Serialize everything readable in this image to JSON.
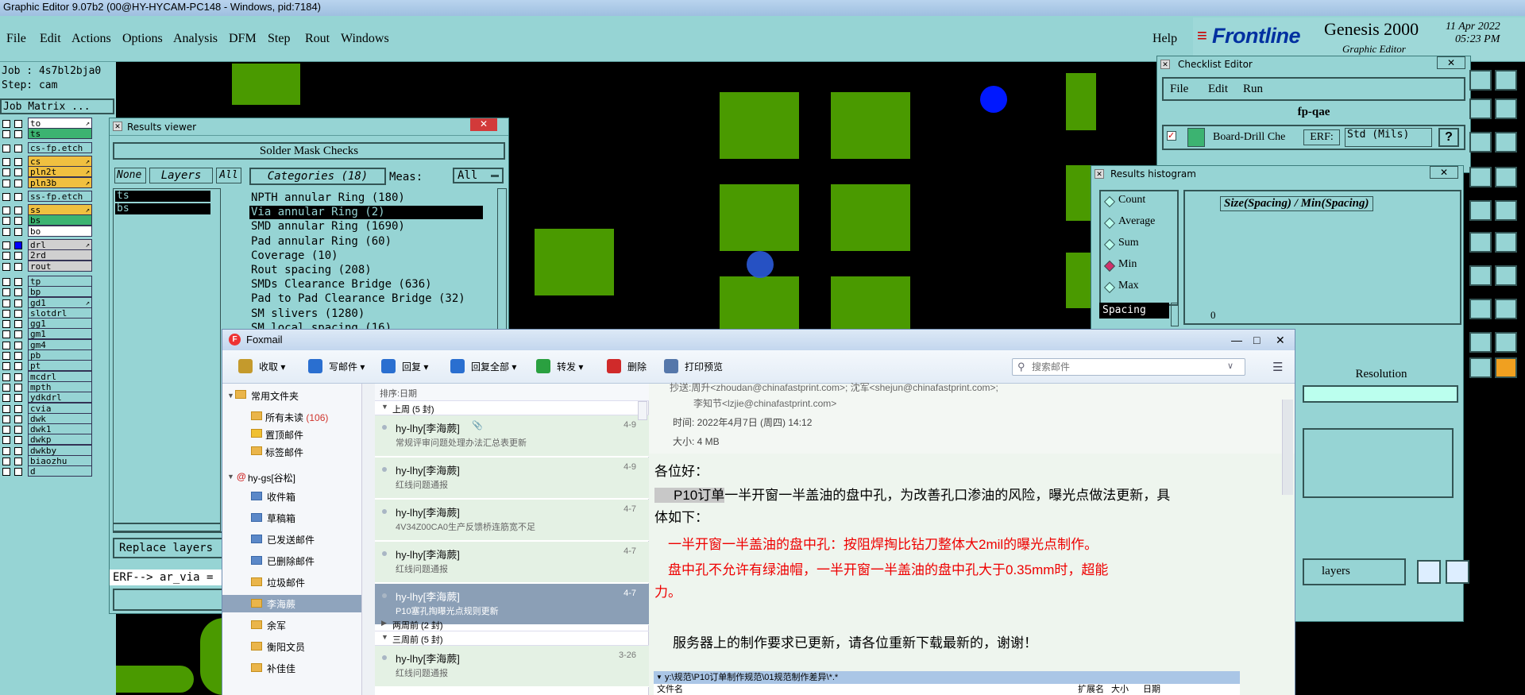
{
  "window_title": "Graphic Editor 9.07b2 (00@HY-HYCAM-PC148 - Windows, pid:7184)",
  "menu": [
    "File",
    "Edit",
    "Actions",
    "Options",
    "Analysis",
    "DFM",
    "Step",
    "Rout",
    "Windows"
  ],
  "help": "Help",
  "brand": {
    "logo": "Frontline",
    "product": "Genesis 2000",
    "subtitle": "Graphic Editor",
    "date": "11 Apr 2022",
    "time": "05:23 PM"
  },
  "job": {
    "job_line": "Job : 4s7bl2bja0",
    "step_line": "Step: cam",
    "matrix_button": "Job Matrix ..."
  },
  "layers": [
    {
      "name": "to",
      "color": "#ffffff",
      "arrow": true
    },
    {
      "name": "ts",
      "color": "#3cb371"
    },
    {
      "name": "cs-fp.etch",
      "color": "#96d4d4"
    },
    {
      "name": "cs",
      "color": "#f0c040",
      "arrow": true
    },
    {
      "name": "pln2t",
      "color": "#f0c040",
      "arrow": true
    },
    {
      "name": "pln3b",
      "color": "#f0c040",
      "arrow": true
    },
    {
      "name": "ss-fp.etch",
      "color": "#96d4d4"
    },
    {
      "name": "ss",
      "color": "#f0c040",
      "arrow": true
    },
    {
      "name": "bs",
      "color": "#3cb371"
    },
    {
      "name": "bo",
      "color": "#ffffff"
    },
    {
      "name": "drl",
      "color": "#d0d0d0",
      "arrow": true
    },
    {
      "name": "2rd",
      "color": "#d0d0d0"
    },
    {
      "name": "rout",
      "color": "#d0d0d0"
    },
    {
      "name": "tp",
      "color": "#96d4d4"
    },
    {
      "name": "bp",
      "color": "#96d4d4"
    },
    {
      "name": "gd1",
      "color": "#96d4d4",
      "arrow": true
    },
    {
      "name": "slotdrl",
      "color": "#96d4d4"
    },
    {
      "name": "gg1",
      "color": "#96d4d4"
    },
    {
      "name": "gm1",
      "color": "#96d4d4"
    },
    {
      "name": "gm4",
      "color": "#96d4d4"
    },
    {
      "name": "pb",
      "color": "#96d4d4"
    },
    {
      "name": "pt",
      "color": "#96d4d4"
    },
    {
      "name": "mcdrl",
      "color": "#96d4d4"
    },
    {
      "name": "mpth",
      "color": "#96d4d4"
    },
    {
      "name": "ydkdrl",
      "color": "#96d4d4"
    },
    {
      "name": "cvia",
      "color": "#96d4d4"
    },
    {
      "name": "dwk",
      "color": "#96d4d4"
    },
    {
      "name": "dwk1",
      "color": "#96d4d4"
    },
    {
      "name": "dwkp",
      "color": "#96d4d4"
    },
    {
      "name": "dwkby",
      "color": "#96d4d4"
    },
    {
      "name": "biaozhu",
      "color": "#96d4d4"
    },
    {
      "name": "d",
      "color": "#96d4d4"
    }
  ],
  "results_viewer": {
    "title": "Results viewer",
    "header": "Solder Mask Checks",
    "none_btn": "None",
    "layers_label": "Layers",
    "all_btn": "All",
    "categories_label": "Categories (18)",
    "meas_label": "Meas:",
    "meas_value": "All",
    "layer_items": [
      "ts",
      "bs"
    ],
    "categories": [
      "NPTH annular Ring (180)",
      "Via annular Ring (2)",
      "SMD annular Ring (1690)",
      "Pad annular Ring (60)",
      "Coverage (10)",
      "Rout spacing (208)",
      "SMDs Clearance Bridge (636)",
      "Pad to Pad Clearance Bridge (32)",
      "SM slivers (1280)",
      "SM local spacing (16)"
    ],
    "replace_btn": "Replace layers",
    "erf_line": "ERF--> ar_via ="
  },
  "checklist_editor": {
    "title": "Checklist Editor",
    "menu": [
      "File",
      "Edit",
      "Run"
    ],
    "name": "fp-qae",
    "row_label": "Board-Drill Che",
    "erf_label": "ERF:",
    "erf_value": "Std (Mils)",
    "help": "?"
  },
  "histogram": {
    "title": "Results histogram",
    "options": [
      "Count",
      "Average",
      "Sum",
      "Min",
      "Max"
    ],
    "selected": "Min",
    "chart_title": "Size(Spacing) / Min(Spacing)",
    "spacing_btn": "Spacing",
    "zero_label": "0",
    "resolution_label": "Resolution",
    "layers_label": "layers"
  },
  "foxmail": {
    "title": "Foxmail",
    "toolbar": [
      {
        "label": "收取",
        "icon": "inbox-icon"
      },
      {
        "label": "写邮件",
        "icon": "pen-icon"
      },
      {
        "label": "回复",
        "icon": "reply-icon"
      },
      {
        "label": "回复全部",
        "icon": "reply-all-icon"
      },
      {
        "label": "转发",
        "icon": "forward-icon"
      },
      {
        "label": "删除",
        "icon": "delete-icon"
      },
      {
        "label": "打印预览",
        "icon": "print-icon"
      }
    ],
    "search_placeholder": "搜索邮件",
    "folders_header": "常用文件夹",
    "folders_common": [
      {
        "name": "所有未读",
        "count": "(106)"
      },
      {
        "name": "置顶邮件"
      },
      {
        "name": "标签邮件"
      }
    ],
    "account": "hy-gs[谷松]",
    "folders_account": [
      "收件箱",
      "草稿箱",
      "已发送邮件",
      "已删除邮件",
      "垃圾邮件",
      "李海蕨",
      "余军",
      "衡阳文员",
      "补佳佳"
    ],
    "sort_label": "排序:日期",
    "group_last_week": "上周 (5 封)",
    "group_two_weeks": "两周前 (2 封)",
    "group_three_weeks": "三周前 (5 封)",
    "messages": [
      {
        "from": "hy-lhy[李海蕨]",
        "date": "4-9",
        "subject": "常规评审问题处理办法汇总表更新",
        "attach": true
      },
      {
        "from": "hy-lhy[李海蕨]",
        "date": "4-9",
        "subject": "红线问题通报"
      },
      {
        "from": "hy-lhy[李海蕨]",
        "date": "4-7",
        "subject": "4V34Z00CA0生产反馈桥连筋宽不足"
      },
      {
        "from": "hy-lhy[李海蕨]",
        "date": "4-7",
        "subject": "红线问题通报"
      },
      {
        "from": "hy-lhy[李海蕨]",
        "date": "4-7",
        "subject": "P10塞孔掏曝光点规则更新",
        "selected": true
      }
    ],
    "message_bottom": {
      "from": "hy-lhy[李海蕨]",
      "date": "3-26",
      "subject": "红线问题通报"
    },
    "read": {
      "cc_line": "抄送:周升<zhoudan@chinafastprint.com>; 沈军<shejun@chinafastprint.com>;",
      "cc_line2": "李知节<lzjie@chinafastprint.com>",
      "time_line": "时间: 2022年4月7日 (周四) 14:12",
      "size_line": "大小: 4 MB",
      "greeting": "各位好：",
      "body1a": "P10订单",
      "body1b": "一半开窗一半盖油的盘中孔，为改善孔口渗油的风险，曝光点做法更新，具",
      "body1c": "体如下：",
      "red1": "一半开窗一半盖油的盘中孔：按阻焊掏比钻刀整体大2mil的曝光点制作。",
      "red2a": "盘中孔不允许有绿油帽，一半开窗一半盖油的盘中孔大于0.35mm时，超能",
      "red2b": "力。",
      "body2": "服务器上的制作要求已更新，请各位重新下载最新的，谢谢！",
      "path": "y:\\规范\\P10订单制作规范\\01规范制作差异\\*.*",
      "col_name": "文件名",
      "col_ext": "扩展名",
      "col_size": "大小",
      "col_date": "日期"
    }
  }
}
